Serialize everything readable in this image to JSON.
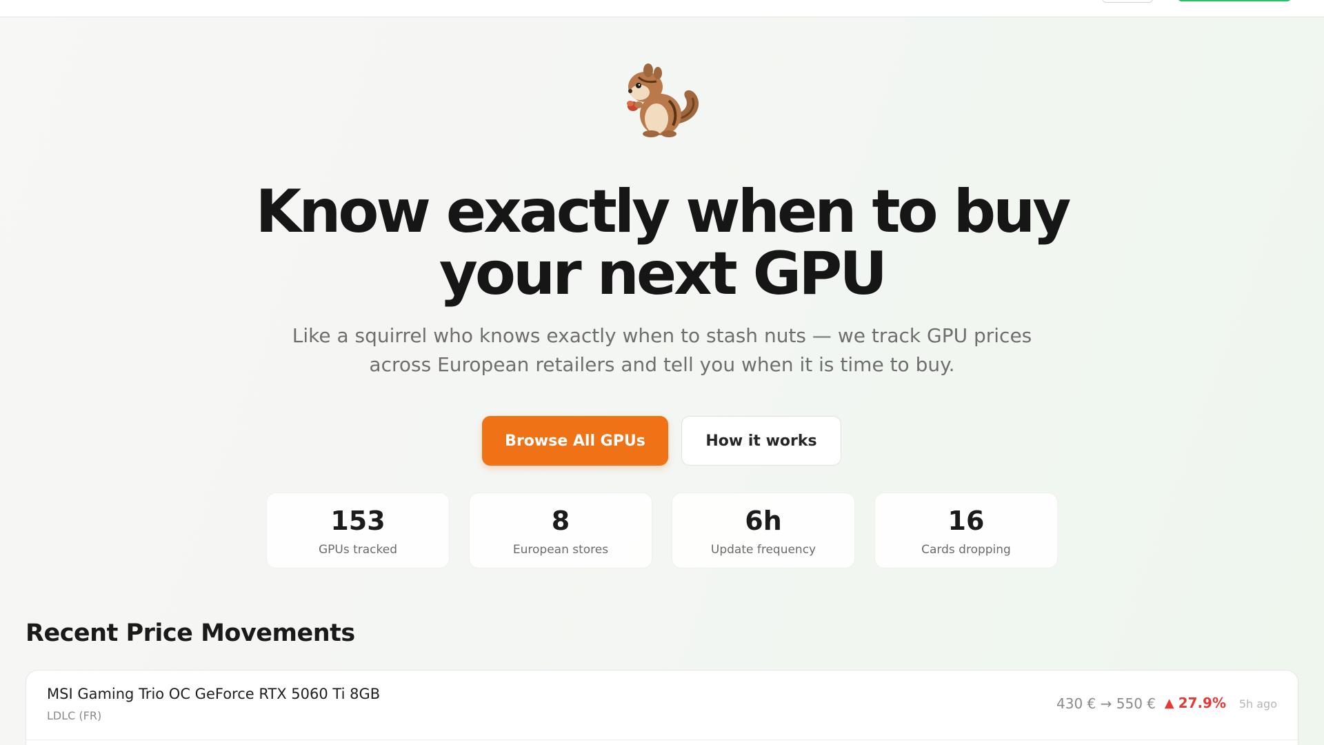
{
  "hero": {
    "headline_line1": "Know exactly when to buy",
    "headline_line2": "your next GPU",
    "subhead_line1": "Like a squirrel who knows exactly when to stash nuts — we track GPU prices",
    "subhead_line2": "across European retailers and tell you when it is time to buy.",
    "mascot_icon": "chipmunk-icon"
  },
  "actions": {
    "primary_label": "Browse All GPUs",
    "secondary_label": "How it works",
    "primary_color": "#f07216"
  },
  "stats": [
    {
      "value": "153",
      "label": "GPUs tracked"
    },
    {
      "value": "8",
      "label": "European stores"
    },
    {
      "value": "6h",
      "label": "Update frequency"
    },
    {
      "value": "16",
      "label": "Cards dropping"
    }
  ],
  "movements": {
    "title": "Recent Price Movements",
    "rows": [
      {
        "name": "MSI Gaming Trio OC GeForce RTX 5060 Ti 8GB",
        "store": "LDLC (FR)",
        "prices": "430 € → 550 €",
        "change": "27.9%",
        "change_icon": "up-triangle-icon",
        "ago": "5h ago",
        "change_color": "#e53935"
      }
    ]
  }
}
